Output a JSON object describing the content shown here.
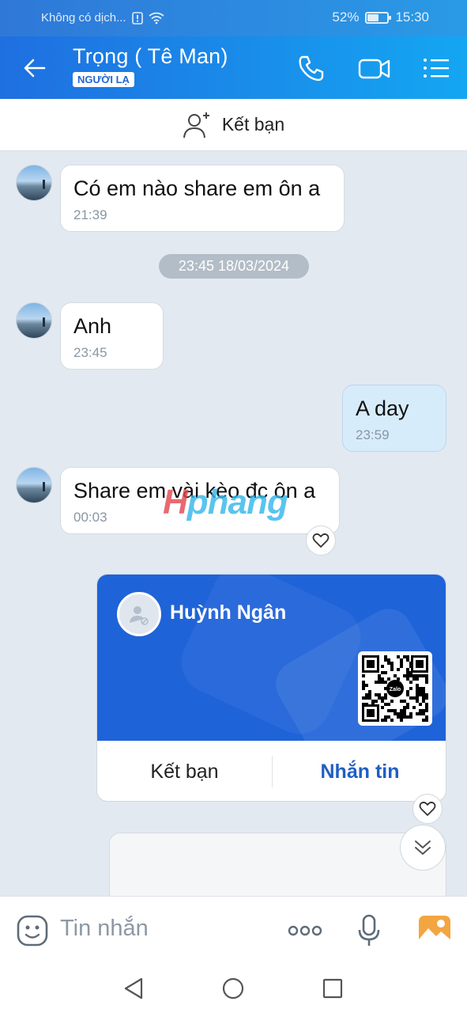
{
  "status_bar": {
    "carrier": "Không có dịch...",
    "battery_percent": "52%",
    "battery_level": 0.52,
    "time": "15:30"
  },
  "header": {
    "contact_name": "Trọng ( Tê Man)",
    "badge": "NGƯỜI LẠ",
    "icons": [
      "back-arrow-icon",
      "phone-icon",
      "video-call-icon",
      "menu-list-icon"
    ]
  },
  "add_friend_banner": {
    "label": "Kết bạn",
    "icon": "add-person-icon"
  },
  "messages": [
    {
      "sender": "them",
      "text": "Có em nào share em ôn a",
      "time": "21:39"
    },
    {
      "sender": "them",
      "text": "Anh",
      "time": "23:45"
    },
    {
      "sender": "me",
      "text": "A day",
      "time": "23:59"
    },
    {
      "sender": "them",
      "text": "Share em vài kèo đc ôn a",
      "time": "00:03"
    }
  ],
  "date_separator": "23:45 18/03/2024",
  "watermark": {
    "part1": "H",
    "part2": "phang"
  },
  "contact_card": {
    "name": "Huỳnh Ngân",
    "qr_label": "Zalo",
    "add_friend_label": "Kết bạn",
    "message_label": "Nhắn tin"
  },
  "composer": {
    "placeholder": "Tin nhắn",
    "icons": [
      "sticker-icon",
      "more-options-icon",
      "microphone-icon",
      "image-icon"
    ]
  },
  "colors": {
    "header_start": "#1f6fe0",
    "header_end": "#14a6f2",
    "card_blue": "#1f63d8",
    "my_bubble": "#d7ecfb",
    "chat_bg": "#e2e9f1"
  }
}
